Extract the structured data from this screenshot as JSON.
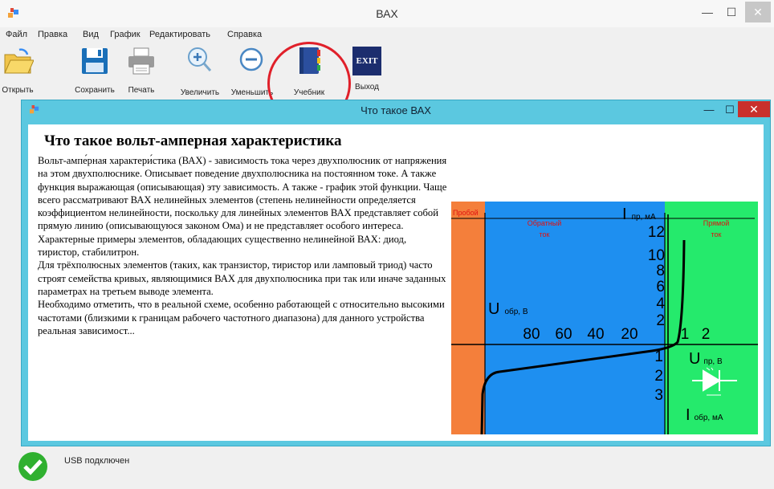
{
  "window": {
    "title": "ВАХ",
    "min": "—",
    "max": "☐",
    "close": "✕"
  },
  "menu": [
    "Файл",
    "Правка",
    "Вид",
    "График",
    "Редактировать",
    "Справка"
  ],
  "toolbar": [
    {
      "label": "Открыть",
      "icon": "open-folder-icon"
    },
    {
      "label": "Сохранить",
      "icon": "save-icon"
    },
    {
      "label": "Печать",
      "icon": "print-icon"
    },
    {
      "label": "Увеличить",
      "icon": "zoom-in-icon"
    },
    {
      "label": "Уменьшить",
      "icon": "zoom-out-icon"
    },
    {
      "label": "Учебник",
      "icon": "book-icon"
    },
    {
      "label": "Выход",
      "icon": "exit-icon",
      "badge": "EXIT"
    }
  ],
  "child_window": {
    "title": "Что такое ВАХ",
    "min": "—",
    "max": "☐",
    "close": "✕",
    "heading": "Что такое вольт-амперная характеристика",
    "paragraphs": [
      "Вольт-ампе́рная характери́стика (ВАХ) - зависимость тока через двухполюсник от напряжения на этом двухполюснике. Описывает поведение двухполюсника на постоянном токе. А также функция выражающая (описывающая) эту зависимость. А также - график этой функции. Чаще всего рассматривают ВАХ нелинейных элементов (степень нелинейности определяется коэффициентом нелинейности, поскольку для линейных элементов ВАХ представляет собой прямую линию (описывающуюся законом Ома) и не представляет особого интереса.",
      "Характерные примеры элементов, обладающих существенно нелинейной ВАХ: диод, тиристор, стабилитрон.",
      "Для трёхполюсных элементов (таких, как транзистор, тиристор или ламповый триод) часто строят семейства кривых, являющимися ВАХ для двухполюсника при так или иначе заданных параметрах на третьем выводе элемента.",
      "Необходимо отметить, что в реальной схеме, особенно работающей с относительно высокими частотами (близкими к границам рабочего частотного диапазона) для данного устройства реальная зависимост..."
    ]
  },
  "diagram": {
    "zone_breakdown": "Пробой",
    "zone_reverse": "Обратный ток",
    "zone_forward": "Прямой ток",
    "i_forward": "I пр, мА",
    "u_reverse": "U обр, В",
    "u_forward": "U пр, В",
    "i_reverse": "I обр, мА",
    "y_up_ticks": [
      "12",
      "10",
      "8",
      "6",
      "4",
      "2"
    ],
    "y_down_ticks": [
      "1",
      "2",
      "3"
    ],
    "x_left_ticks": [
      "80",
      "60",
      "40",
      "20"
    ],
    "x_right_ticks": [
      "1",
      "2"
    ],
    "colors": {
      "breakdown": "#f47f3b",
      "reverse": "#1e8ff0",
      "forward": "#25ea6c",
      "label_red": "#e01010"
    }
  },
  "status": {
    "text": "USB подключен"
  }
}
